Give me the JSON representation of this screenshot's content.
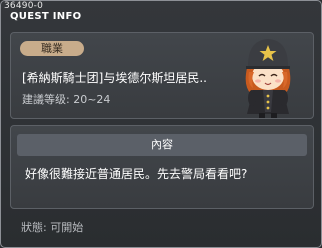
{
  "window": {
    "quest_id": "36490-0",
    "title": "QUEST INFO"
  },
  "quest": {
    "job_badge": "職業",
    "name": "[希納斯騎士团]与埃德尔斯坦居民..",
    "recommended_level": "建議等级: 20~24",
    "npc": "police-girl-npc"
  },
  "content": {
    "header": "內容",
    "text": "好像很難接近普通居民。先去警局看看吧?"
  },
  "status": {
    "text": "狀態: 可開始"
  },
  "colors": {
    "background": "#2b2e31",
    "panel": "#3f4347",
    "badge": "#c8ac8b",
    "header_bar": "#5b6068"
  }
}
